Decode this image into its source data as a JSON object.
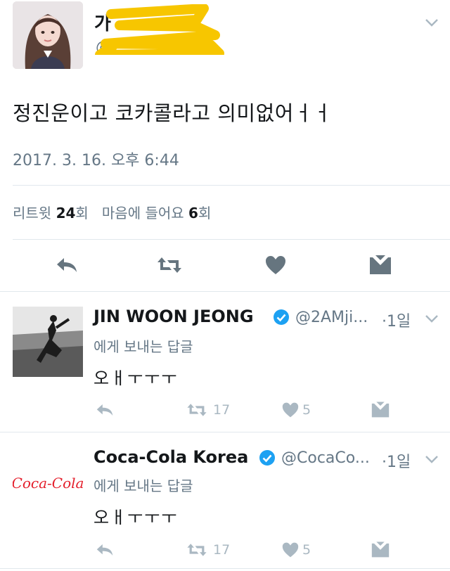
{
  "main_tweet": {
    "text": "정진운이고 코카콜라고 의미없어ㅓㅓ",
    "timestamp": "2017. 3. 16. 오후 6:44",
    "stats": {
      "retweet_label": "리트윗",
      "retweet_count": "24",
      "retweet_unit": "회",
      "like_label": "마음에 들어요",
      "like_count": "6",
      "like_unit": "회"
    },
    "actions": [
      "reply-icon",
      "retweet-icon",
      "heart-icon",
      "direct-message-icon"
    ]
  },
  "replies": [
    {
      "name": "JIN WOON JEONG",
      "handle": "@2AMji...",
      "time": "·1일",
      "sub": "에게 보내는 답글",
      "text": "오ㅐㅜㅜㅜ",
      "retweets": "17",
      "likes": "5"
    },
    {
      "name": "Coca-Cola Korea",
      "handle": "@CocaCo...",
      "time": "·1일",
      "sub": "에게 보내는 답글",
      "text": "오ㅐㅜㅜㅜ",
      "retweets": "17",
      "likes": "5",
      "logo_text": "Coca-Cola"
    }
  ],
  "colors": {
    "secondary_text": "#657786",
    "icon_gray": "#aab8c2",
    "main_icon_blue": "#66757f",
    "verified_blue": "#1da1f2",
    "redaction_yellow": "#f7c600",
    "coke_red": "#e41e2b"
  }
}
